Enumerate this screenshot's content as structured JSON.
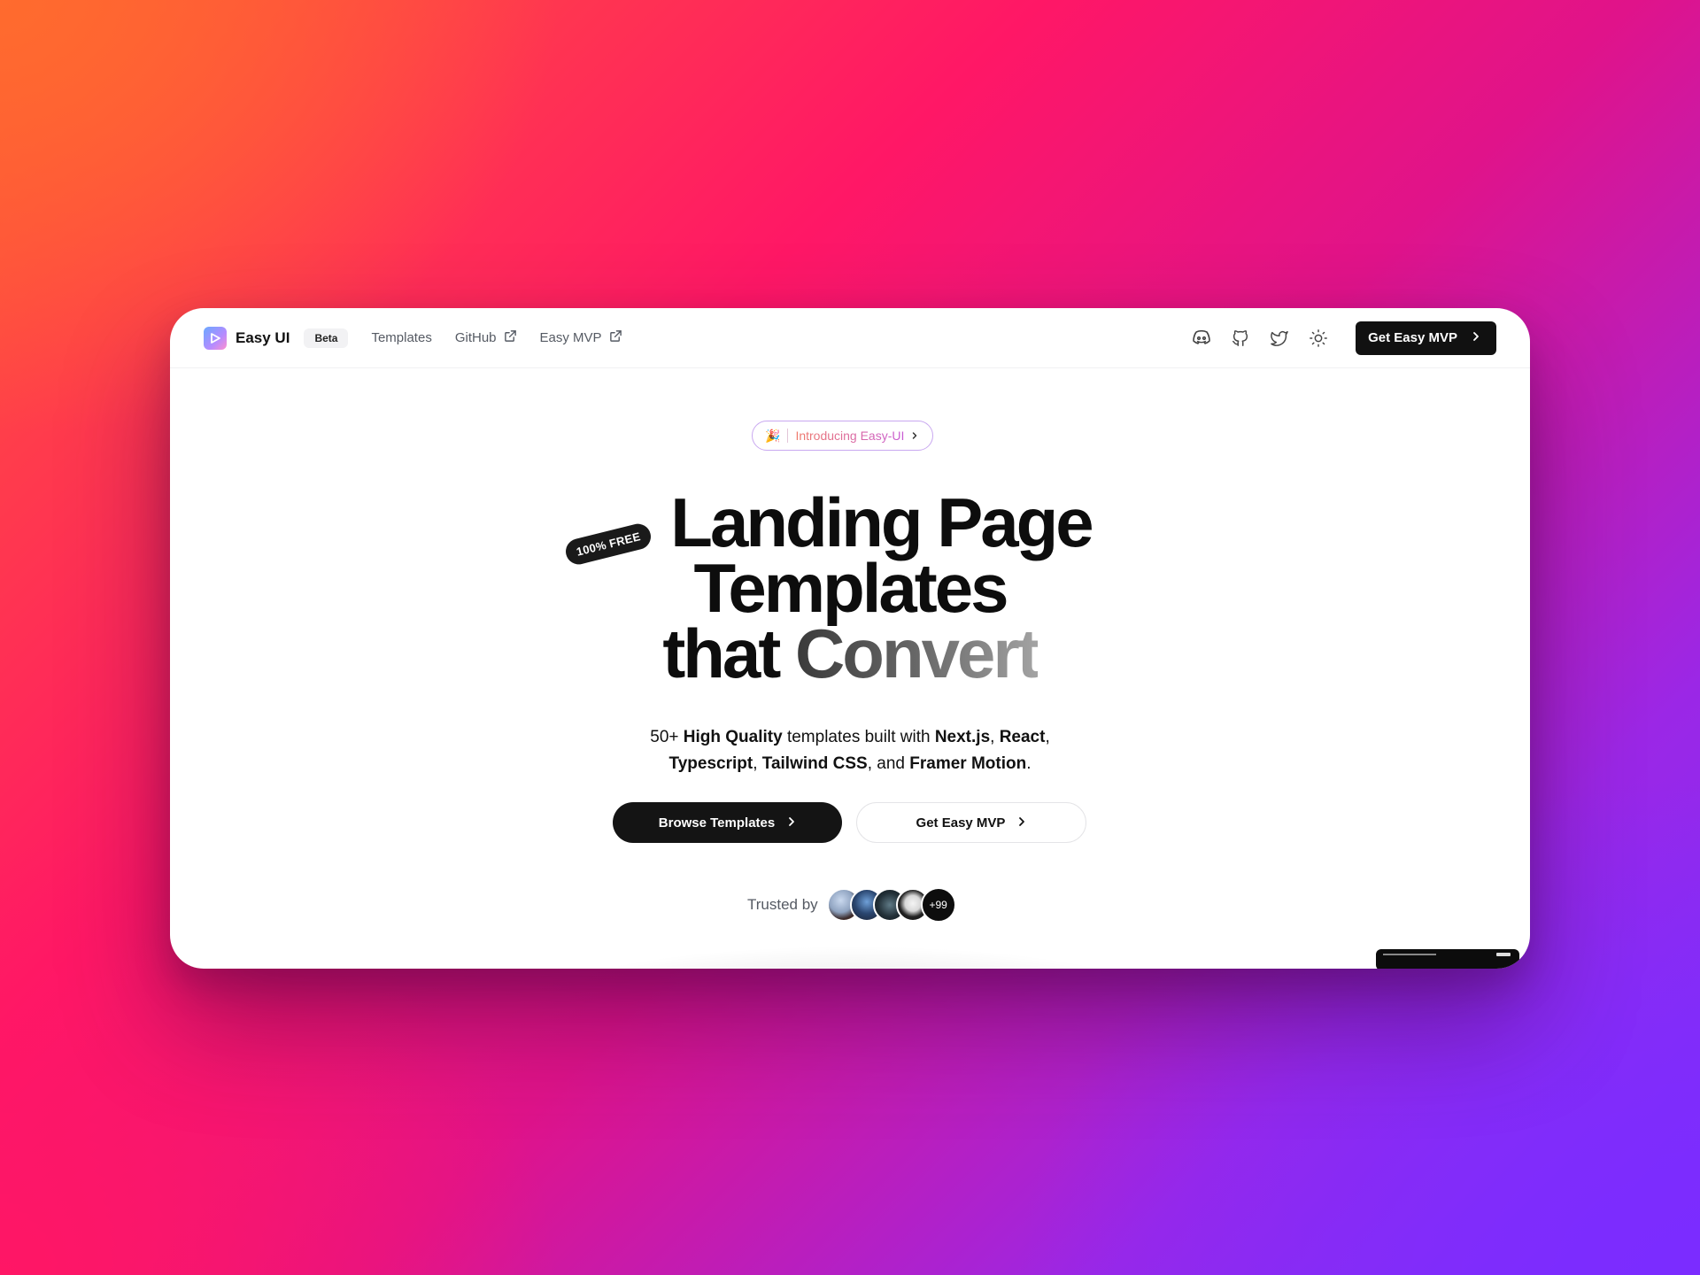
{
  "brand": {
    "name": "Easy UI",
    "badge": "Beta",
    "logo_icon": "play-triangle-icon"
  },
  "nav": {
    "links": [
      {
        "label": "Templates",
        "external": false
      },
      {
        "label": "GitHub",
        "external": true
      },
      {
        "label": "Easy MVP",
        "external": true
      }
    ],
    "icons": [
      "discord-icon",
      "github-icon",
      "twitter-icon",
      "sun-icon"
    ],
    "cta_label": "Get Easy MVP"
  },
  "hero": {
    "announcement_emoji": "🎉",
    "announcement_label": "Introducing Easy-UI",
    "free_tag": "100% FREE",
    "headline": {
      "line1": "Landing Page",
      "line2": "Templates",
      "line3a": "that ",
      "line3b": "Convert"
    },
    "subtitle": {
      "p1": "50+ ",
      "b1": "High Quality",
      "p2": " templates built with ",
      "b2": "Next.js",
      "p3": ", ",
      "b3": "React",
      "p4": ",",
      "b4": "Typescript",
      "p5": ", ",
      "b5": "Tailwind CSS",
      "p6": ", and ",
      "b6": "Framer Motion",
      "p7": "."
    },
    "primary_button": "Browse Templates",
    "secondary_button": "Get Easy MVP",
    "trusted_label": "Trusted by",
    "trusted_more": "+99"
  },
  "colors": {
    "accent_dark": "#111111",
    "badge_gradient_start": "#f07a6a",
    "badge_gradient_end": "#c85bd4"
  }
}
